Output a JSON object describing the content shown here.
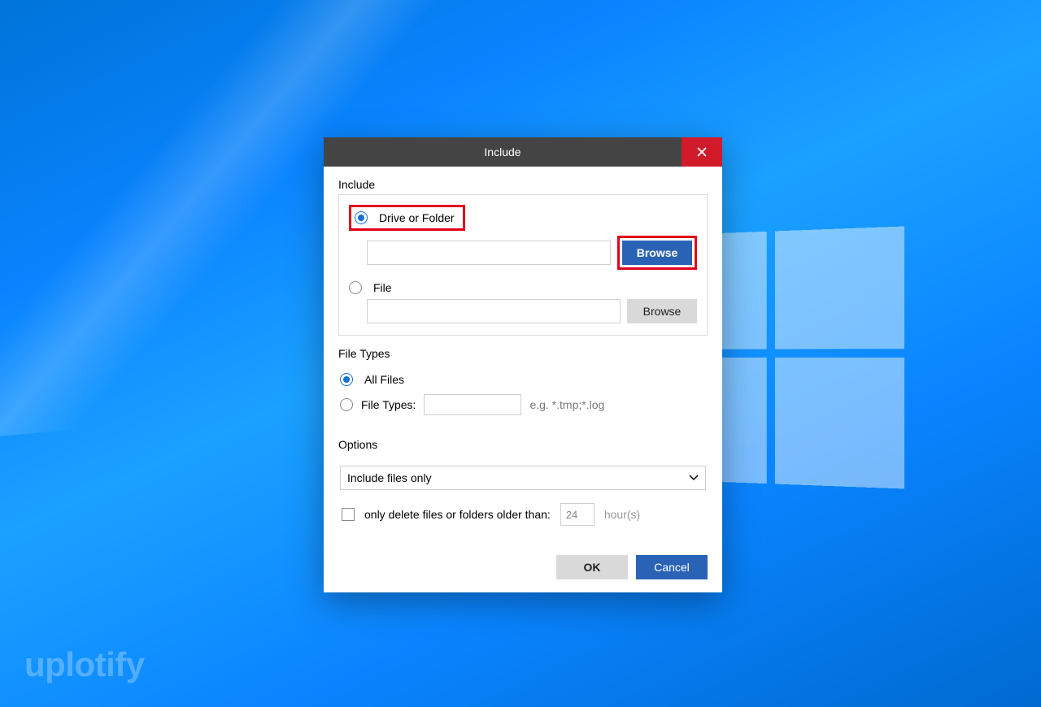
{
  "watermark": "uplotify",
  "dialog": {
    "title": "Include",
    "include_section": {
      "label": "Include",
      "drive_or_folder": {
        "label": "Drive or Folder",
        "checked": true,
        "path_value": "",
        "browse_label": "Browse"
      },
      "file": {
        "label": "File",
        "checked": false,
        "path_value": "",
        "browse_label": "Browse"
      }
    },
    "file_types_section": {
      "label": "File Types",
      "all_files": {
        "label": "All Files",
        "checked": true
      },
      "file_types": {
        "label": "File Types:",
        "checked": false,
        "value": "",
        "hint": "e.g. *.tmp;*.log"
      }
    },
    "options_section": {
      "label": "Options",
      "select_value": "Include files only",
      "older_than": {
        "checked": false,
        "label": "only delete files or folders older than:",
        "value": "24",
        "unit": "hour(s)"
      }
    },
    "buttons": {
      "ok": "OK",
      "cancel": "Cancel"
    }
  }
}
